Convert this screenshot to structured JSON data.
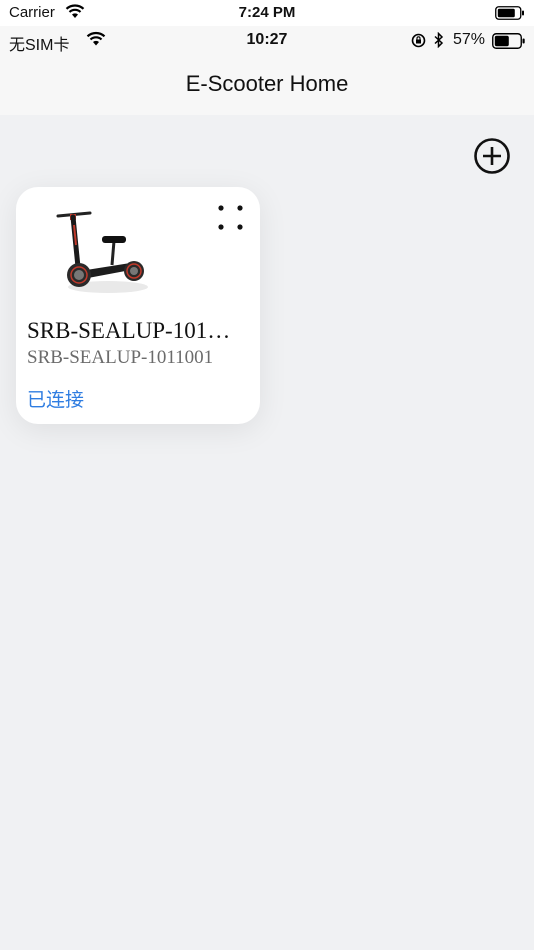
{
  "simulator_status": {
    "carrier": "Carrier",
    "time": "7:24 PM"
  },
  "device_status": {
    "sim": "无SIM卡",
    "time": "10:27",
    "battery_percent": "57%"
  },
  "nav": {
    "title": "E-Scooter Home"
  },
  "devices": [
    {
      "name": "SRB-SEALUP-101…",
      "serial": "SRB-SEALUP-1011001",
      "status": "已连接"
    }
  ],
  "icons": {
    "add": "plus-circle-icon",
    "more": "four-dots-icon",
    "thumbnail": "scooter-image"
  },
  "colors": {
    "background": "#f0f1f3",
    "card": "#ffffff",
    "status_connected": "#2f7de1",
    "subtitle": "#6b6b6b"
  }
}
